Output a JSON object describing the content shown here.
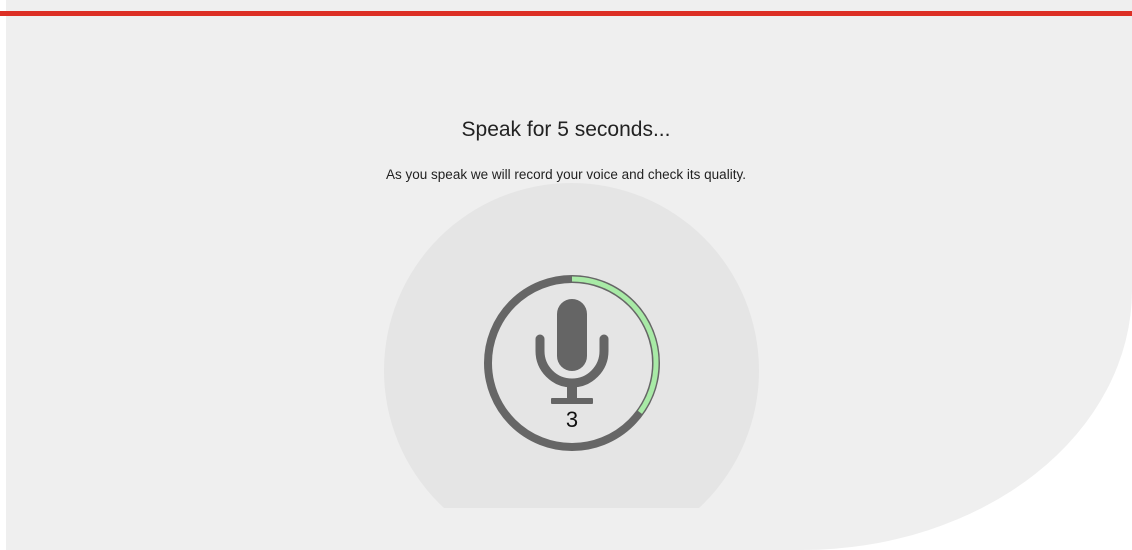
{
  "colors": {
    "accent_bar": "#dc2f24",
    "panel_bg": "#efefef",
    "halo_bg": "#e5e5e5",
    "ring_track": "#666666",
    "progress": "#a8eaa6",
    "mic": "#656565"
  },
  "prompt": {
    "title": "Speak for 5 seconds...",
    "subtitle": "As you speak we will record your voice and check its quality."
  },
  "recorder": {
    "icon": "microphone-icon",
    "countdown": "3",
    "progress_fraction": 0.35
  }
}
